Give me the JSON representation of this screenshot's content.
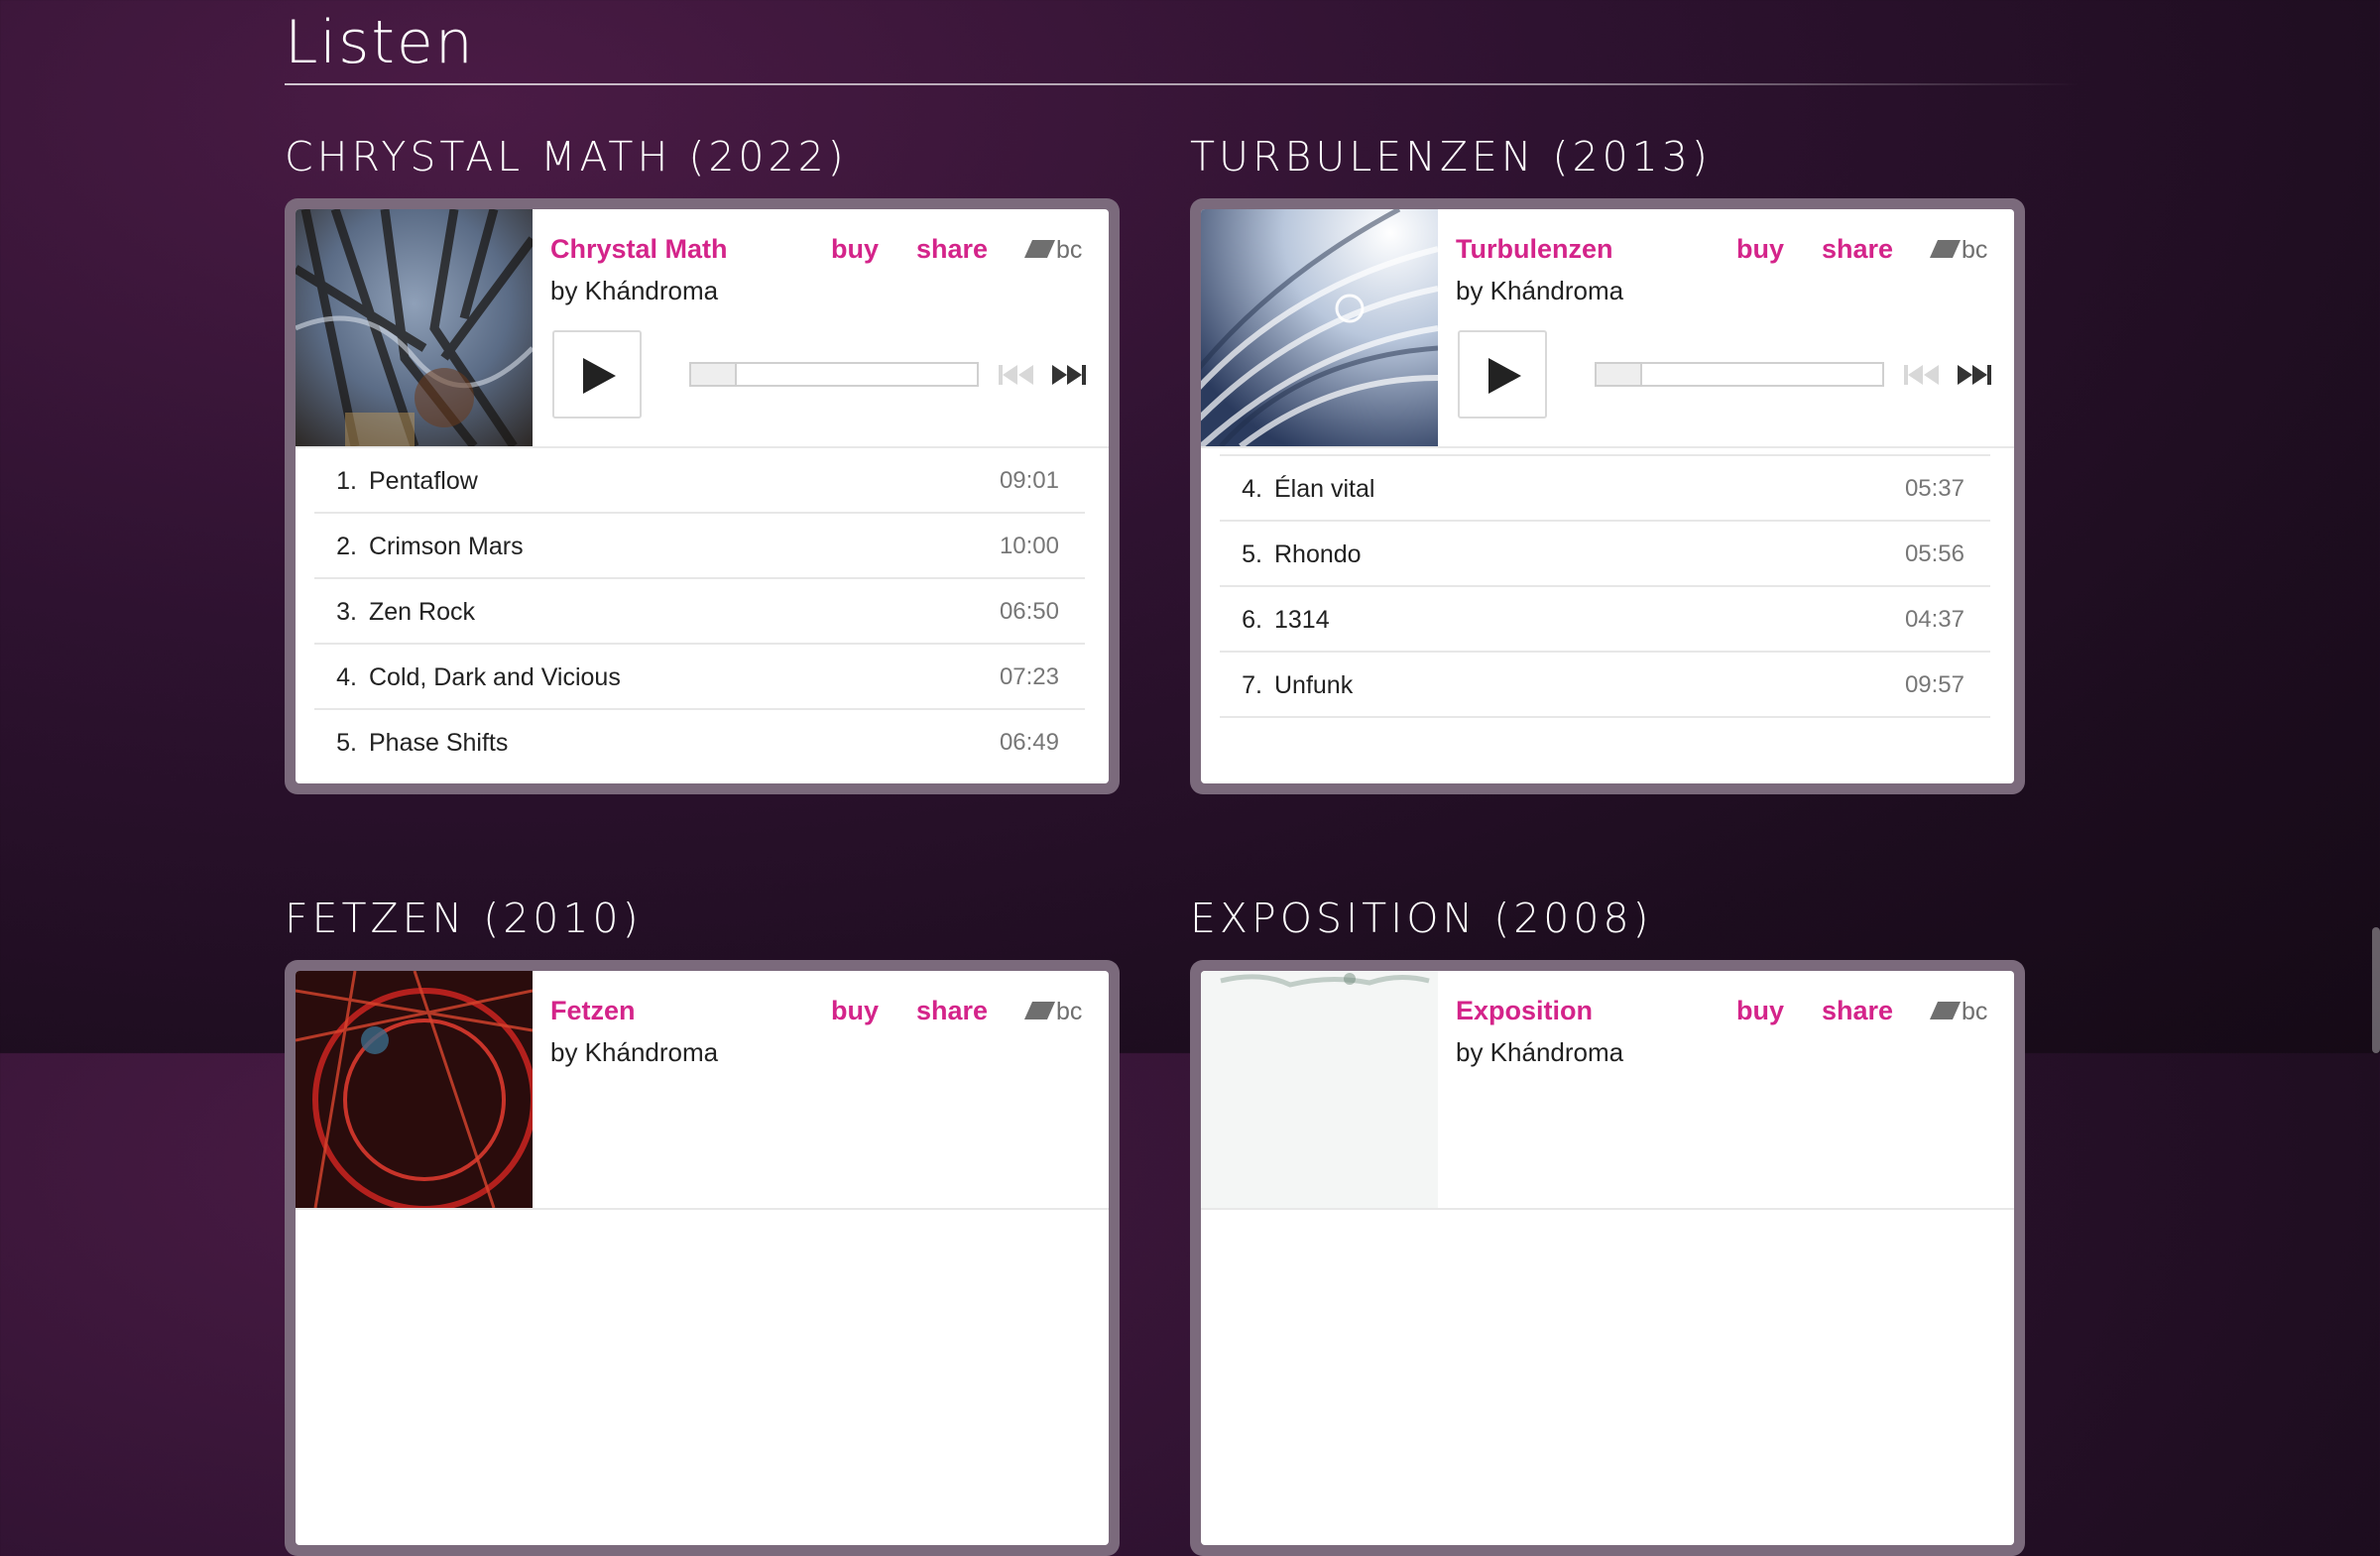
{
  "section": {
    "title": "Listen"
  },
  "albums": [
    {
      "heading": "Chrystal Math (2022)",
      "player": {
        "album_title": "Chrystal Math",
        "artist": "by Khándroma",
        "buy_label": "buy",
        "share_label": "share",
        "logo_text": "bc",
        "tracks": [
          {
            "num": "1.",
            "title": "Pentaflow",
            "duration": "09:01"
          },
          {
            "num": "2.",
            "title": "Crimson Mars",
            "duration": "10:00"
          },
          {
            "num": "3.",
            "title": "Zen Rock",
            "duration": "06:50"
          },
          {
            "num": "4.",
            "title": "Cold, Dark and Vicious",
            "duration": "07:23"
          },
          {
            "num": "5.",
            "title": "Phase Shifts",
            "duration": "06:49"
          }
        ]
      }
    },
    {
      "heading": "Turbulenzen (2013)",
      "player": {
        "album_title": "Turbulenzen",
        "artist": "by Khándroma",
        "buy_label": "buy",
        "share_label": "share",
        "logo_text": "bc",
        "tracks": [
          {
            "num": "4.",
            "title": "Élan vital",
            "duration": "05:37"
          },
          {
            "num": "5.",
            "title": "Rhondo",
            "duration": "05:56"
          },
          {
            "num": "6.",
            "title": "1314",
            "duration": "04:37"
          },
          {
            "num": "7.",
            "title": "Unfunk",
            "duration": "09:57"
          }
        ]
      }
    },
    {
      "heading": "Fetzen (2010)",
      "player": {
        "album_title": "Fetzen",
        "artist": "by Khándroma",
        "buy_label": "buy",
        "share_label": "share",
        "logo_text": "bc"
      }
    },
    {
      "heading": "Exposition (2008)",
      "player": {
        "album_title": "Exposition",
        "artist": "by Khándroma",
        "buy_label": "buy",
        "share_label": "share",
        "logo_text": "bc"
      }
    }
  ],
  "colors": {
    "link": "#d4248a",
    "frame": "#7b6a7c",
    "background": "#2e1230"
  }
}
